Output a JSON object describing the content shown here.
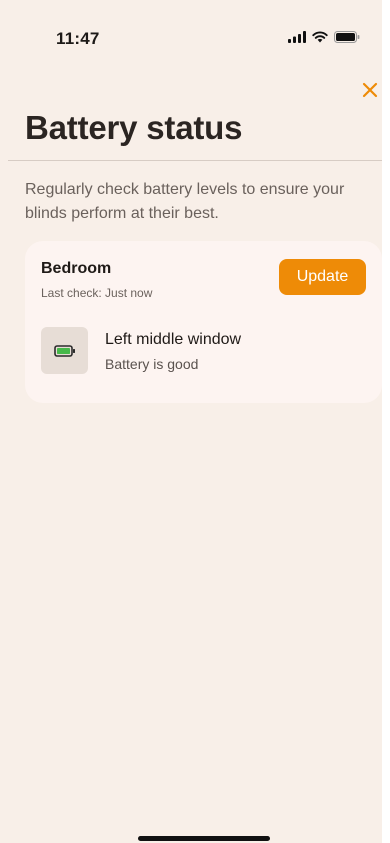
{
  "status_bar": {
    "time": "11:47",
    "icons": [
      "cellular-signal-icon",
      "wifi-icon",
      "battery-icon"
    ]
  },
  "header": {
    "close_icon": "close-icon",
    "title": "Battery status"
  },
  "intro_text": "Regularly check battery levels to ensure your blinds perform at their best.",
  "room": {
    "name": "Bedroom",
    "last_check": "Last check: Just now",
    "update_label": "Update",
    "devices": [
      {
        "icon": "battery-full-icon",
        "name": "Left middle window",
        "status": "Battery is good"
      }
    ]
  },
  "colors": {
    "background": "#f8efe8",
    "card": "#fdf4f1",
    "accent": "#ee8b07",
    "battery_good": "#46b84a"
  }
}
